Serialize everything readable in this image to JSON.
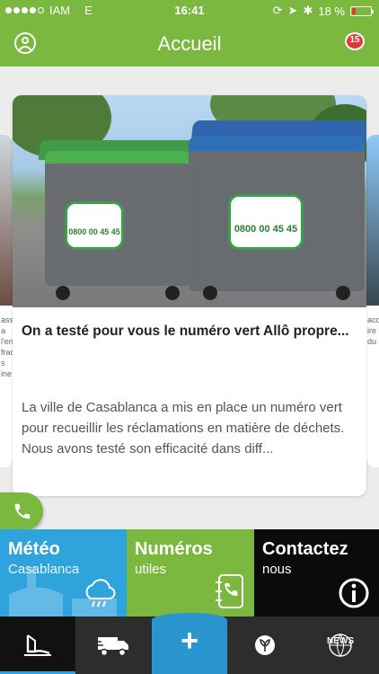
{
  "status": {
    "carrier": "IAM",
    "network": "E",
    "time": "16:41",
    "battery": "18 %",
    "battery_level": 0.18
  },
  "header": {
    "title": "Accueil",
    "notification_count": "15"
  },
  "article": {
    "title": "On a testé pour vous le numéro vert Allô propre...",
    "description": "La ville de Casablanca a mis en place un numéro vert pour recueillir les réclamations en matière de déchets. Nous avons testé son efficacité dans diff...",
    "sticker_number": "0800 00 45 45"
  },
  "side_cards": {
    "left_text": "asse a l'env fract s ine",
    "right_text": "acqu ire du"
  },
  "tiles": [
    {
      "title": "Météo",
      "subtitle": "Casablanca",
      "icon": "cloud-rain-icon"
    },
    {
      "title": "Numéros",
      "subtitle": "utiles",
      "icon": "phone-book-icon"
    },
    {
      "title": "Contactez",
      "subtitle": "nous",
      "icon": "info-icon"
    }
  ],
  "nav": {
    "items": [
      "home-icon",
      "truck-icon",
      "plus-icon",
      "leaf-icon",
      "news-icon"
    ],
    "plus_label": "+",
    "news_label": "NEWS"
  },
  "colors": {
    "brand_green": "#7ab83f",
    "meteo_blue": "#2ea3dc",
    "contact_black": "#0b0b0b",
    "nav_dark": "#2d2d2d",
    "badge_red": "#e53935"
  }
}
